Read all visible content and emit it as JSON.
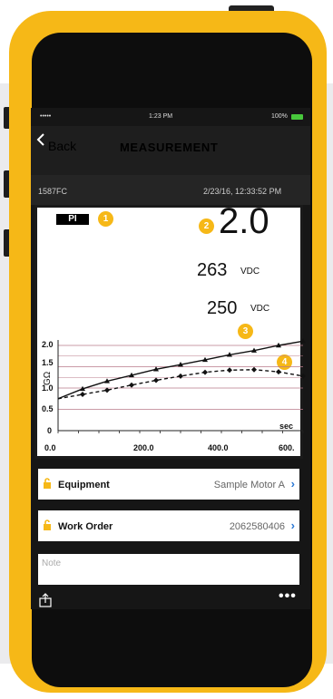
{
  "status": {
    "carrier": "•••••",
    "time": "1:23 PM",
    "battery": "100%"
  },
  "nav": {
    "back_label": "Back",
    "title": "MEASUREMENT"
  },
  "measurement": {
    "device": "1587FC",
    "timestamp": "2/23/16, 12:33:52 PM"
  },
  "readout": {
    "mode": "PI",
    "index_value": "2.0",
    "value1": "263",
    "unit1": "VDC",
    "value2": "250",
    "unit2": "VDC",
    "badges": [
      "1",
      "2",
      "3",
      "4"
    ]
  },
  "chart_data": {
    "type": "line",
    "ylabel": "GΩ",
    "xunit": "sec",
    "yticks": [
      "2.0",
      "1.5",
      "1.0",
      "0.5",
      "0"
    ],
    "xticks": [
      "0.0",
      "200.0",
      "400.0",
      "600."
    ],
    "xlim": [
      0,
      600
    ],
    "ylim": [
      0,
      2.0
    ],
    "series": [
      {
        "style": "solid",
        "marker": "triangle",
        "x": [
          0,
          60,
          120,
          180,
          240,
          300,
          360,
          420,
          480,
          540,
          600
        ],
        "y": [
          0.75,
          0.98,
          1.16,
          1.3,
          1.44,
          1.55,
          1.66,
          1.78,
          1.88,
          2.0,
          2.1
        ]
      },
      {
        "style": "dashed",
        "marker": "diamond",
        "x": [
          0,
          60,
          120,
          180,
          240,
          300,
          360,
          420,
          480,
          540,
          600
        ],
        "y": [
          0.75,
          0.85,
          0.95,
          1.07,
          1.18,
          1.28,
          1.37,
          1.42,
          1.43,
          1.38,
          1.28
        ]
      }
    ]
  },
  "equipment": {
    "label": "Equipment",
    "value": "Sample Motor A"
  },
  "work_order": {
    "label": "Work Order",
    "value": "2062580406"
  },
  "note": {
    "placeholder": "Note"
  },
  "colors": {
    "frame": "#f6b817",
    "accent": "#2a78d5",
    "battery": "#48c83c",
    "lock": "#f6b817"
  }
}
